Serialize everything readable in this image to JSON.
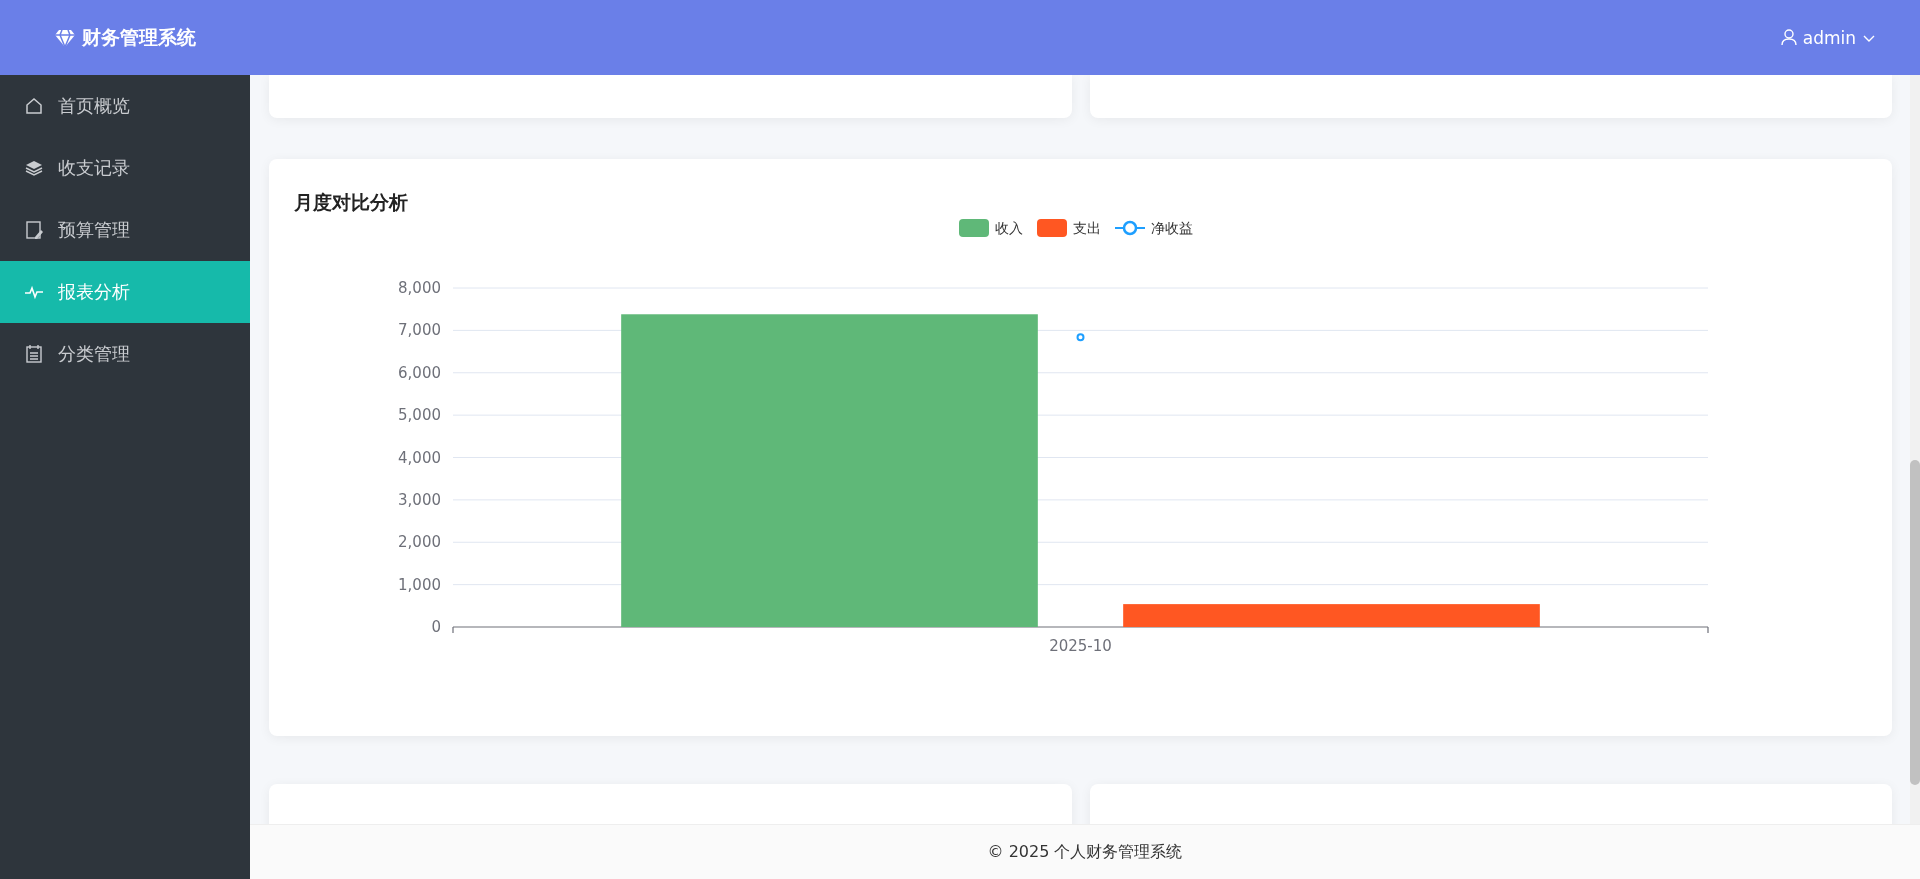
{
  "brand": {
    "title": "财务管理系统"
  },
  "user": {
    "name": "admin"
  },
  "sidebar": {
    "items": [
      {
        "label": "首页概览",
        "selected": false
      },
      {
        "label": "收支记录",
        "selected": false
      },
      {
        "label": "预算管理",
        "selected": false
      },
      {
        "label": "报表分析",
        "selected": true
      },
      {
        "label": "分类管理",
        "selected": false
      }
    ]
  },
  "monthly_card": {
    "title": "月度对比分析",
    "chart_data": {
      "type": "bar",
      "grid": true,
      "legend": "top",
      "categories": [
        "2025-10"
      ],
      "ylim": [
        0,
        8000
      ],
      "yticks": [
        {
          "value": 0,
          "label": "0"
        },
        {
          "value": 1000,
          "label": "1,000"
        },
        {
          "value": 2000,
          "label": "2,000"
        },
        {
          "value": 3000,
          "label": "3,000"
        },
        {
          "value": 4000,
          "label": "4,000"
        },
        {
          "value": 5000,
          "label": "5,000"
        },
        {
          "value": 6000,
          "label": "6,000"
        },
        {
          "value": 7000,
          "label": "7,000"
        },
        {
          "value": 8000,
          "label": "8,000"
        }
      ],
      "series": [
        {
          "name": "收入",
          "type": "bar",
          "color": "#5fb878",
          "values": [
            7380
          ]
        },
        {
          "name": "支出",
          "type": "bar",
          "color": "#ff5722",
          "values": [
            540
          ]
        },
        {
          "name": "净收益",
          "type": "line",
          "marker": "circle",
          "color": "#1e9fff",
          "values": [
            6840
          ]
        }
      ]
    }
  },
  "footer": {
    "text": "© 2025 个人财务管理系统"
  }
}
